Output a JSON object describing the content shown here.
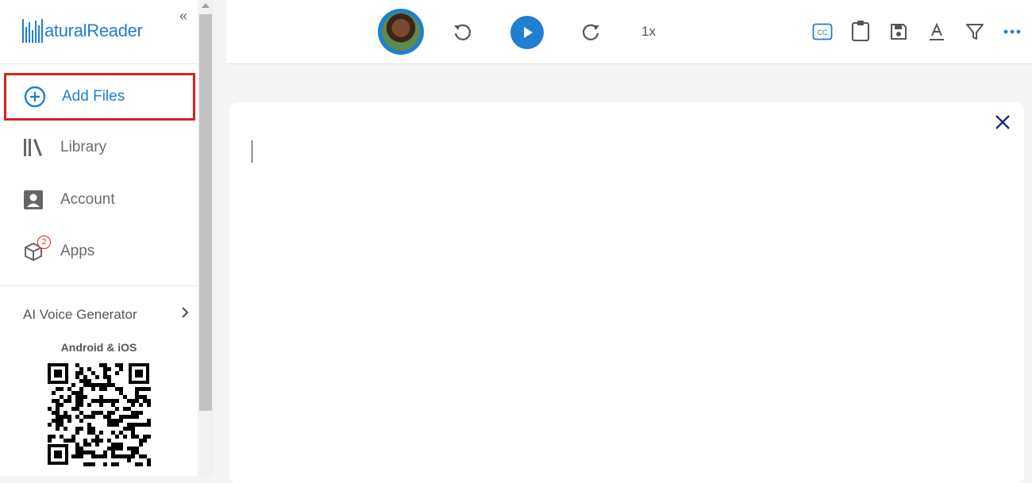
{
  "sidebar": {
    "logo_text": "aturalReader",
    "collapse_symbol": "«",
    "items": [
      {
        "label": "Add Files",
        "icon": "add-circle-icon"
      },
      {
        "label": "Library",
        "icon": "library-icon"
      },
      {
        "label": "Account",
        "icon": "account-icon"
      },
      {
        "label": "Apps",
        "icon": "apps-box-icon",
        "badge": "2"
      }
    ],
    "voice_generator_label": "AI Voice Generator",
    "mobile_label": "Android & iOS"
  },
  "toolbar": {
    "speed": "1x",
    "icons": [
      "avatar",
      "rewind-icon",
      "play-icon",
      "forward-icon",
      "cc-icon",
      "clipboard-icon",
      "save-icon",
      "text-format-icon",
      "filter-icon",
      "more-icon"
    ]
  },
  "colors": {
    "accent": "#1f7fd0",
    "highlight": "#dc1f1f"
  }
}
